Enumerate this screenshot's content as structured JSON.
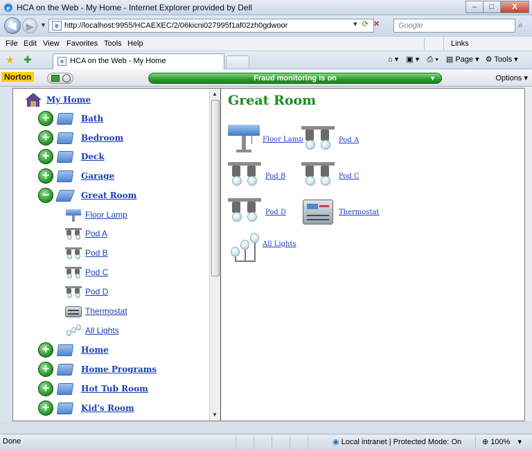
{
  "window": {
    "title": "HCA on the Web - My Home - Internet Explorer provided by Dell",
    "controls": {
      "minimize": "–",
      "maximize": "□",
      "close": "X"
    }
  },
  "address": {
    "url": "http://localhost:9955/HCAEXEC/2/06kicni027995f1af02zh0gdwoor",
    "search_placeholder": "Google"
  },
  "menu": {
    "items": [
      "File",
      "Edit",
      "View",
      "Favorites",
      "Tools",
      "Help"
    ],
    "links": "Links"
  },
  "tabs": {
    "active": "HCA on the Web - My Home",
    "tools": {
      "page": "Page",
      "tools": "Tools"
    }
  },
  "norton": {
    "brand": "Norton",
    "status": "Fraud monitoring is on",
    "options": "Options"
  },
  "tree": {
    "root": "My Home",
    "folders": [
      "Bath",
      "Bedroom",
      "Deck",
      "Garage",
      "Great Room",
      "Home",
      "Home Programs",
      "Hot Tub Room",
      "Kid's Room"
    ],
    "expanded": "Great Room",
    "great_room_children": [
      "Floor Lamp",
      "Pod A",
      "Pod B",
      "Pod C",
      "Pod D",
      "Thermostat",
      "All Lights"
    ]
  },
  "room": {
    "title": "Great Room",
    "devices": [
      "Floor Lamp",
      "Pod A",
      "Pod B",
      "Pod C",
      "Pod D",
      "Thermostat",
      "All Lights"
    ]
  },
  "status": {
    "left": "Done",
    "zone": "Local intranet | Protected Mode: On",
    "zoom": "100%"
  },
  "colors": {
    "link": "#1a3fb6",
    "room_title": "#1e8a1e",
    "fraud_bar": "#2a9b2a"
  }
}
